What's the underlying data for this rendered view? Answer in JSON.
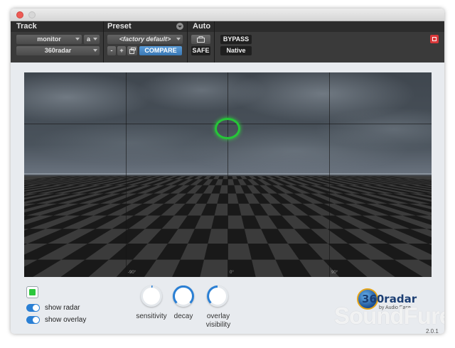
{
  "header": {
    "track_label": "Track",
    "preset_label": "Preset",
    "auto_label": "Auto",
    "track_dropdown": "monitor",
    "channel_dropdown": "a",
    "plugin_dropdown": "360radar",
    "preset_dropdown": "<factory default>",
    "minus_label": "-",
    "plus_label": "+",
    "compare_label": "COMPARE",
    "bypass_label": "BYPASS",
    "safe_label": "SAFE",
    "native_label": "Native"
  },
  "viewport": {
    "deg_left": "-90°",
    "deg_center": "0°",
    "deg_right": "90°"
  },
  "controls": {
    "show_radar_label": "show radar",
    "show_overlay_label": "show overlay",
    "show_radar_on": true,
    "show_overlay_on": true,
    "sensitivity_label": "sensitivity",
    "decay_label": "decay",
    "overlay_visibility_label_1": "overlay",
    "overlay_visibility_label_2": "visibility"
  },
  "logo": {
    "name": "360radar",
    "subtitle": "by Audio Ease",
    "watermark": "SoundFure",
    "version": "2.0.1"
  },
  "colors": {
    "accent_blue": "#2a7fd4",
    "radar_green": "#26c638",
    "header_bg": "#3a3a3a"
  }
}
